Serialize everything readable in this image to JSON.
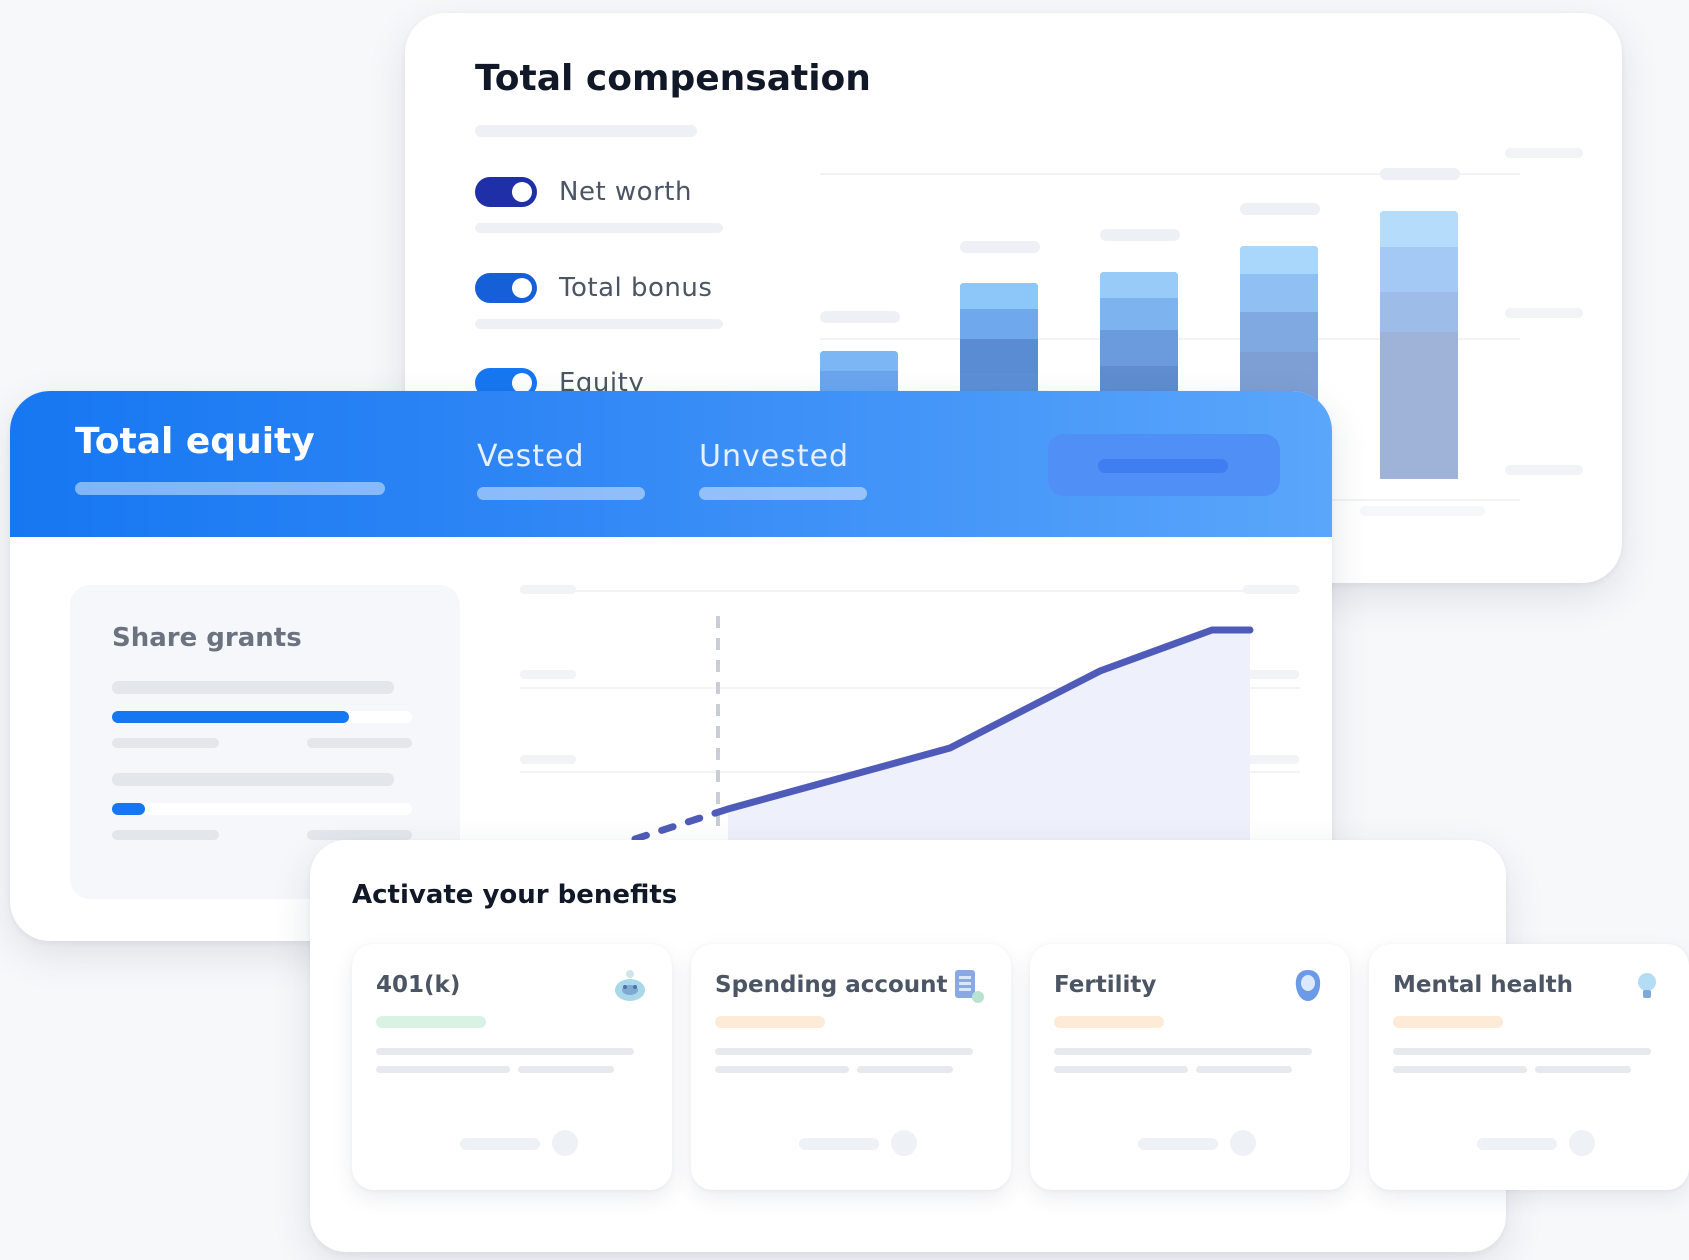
{
  "compensation": {
    "title": "Total compensation",
    "toggles": [
      {
        "label": "Net worth",
        "on": true,
        "color": "#1f2fa8"
      },
      {
        "label": "Total bonus",
        "on": true,
        "color": "#1560d9"
      },
      {
        "label": "Equity",
        "on": true,
        "color": "#1677f2"
      }
    ]
  },
  "equity": {
    "title": "Total equity",
    "tabs": [
      {
        "label": "Vested"
      },
      {
        "label": "Unvested"
      }
    ],
    "share_grants": {
      "title": "Share grants",
      "grants": [
        {
          "progress": 0.79
        },
        {
          "progress": 0.11
        }
      ]
    }
  },
  "benefits": {
    "title": "Activate your benefits",
    "items": [
      {
        "label": "401(k)",
        "icon": "piggy-bank-icon",
        "tag_color": "#d8f3e4"
      },
      {
        "label": "Spending account",
        "icon": "receipt-icon",
        "tag_color": "#fdebd8"
      },
      {
        "label": "Fertility",
        "icon": "fertility-icon",
        "tag_color": "#fdebd8"
      },
      {
        "label": "Mental health",
        "icon": "lightbulb-icon",
        "tag_color": "#fdebd8"
      }
    ]
  },
  "colors": {
    "primary": "#1677f2",
    "line": "#4f5bb8",
    "text_dark": "#111827",
    "text_muted": "#6b7280"
  }
}
